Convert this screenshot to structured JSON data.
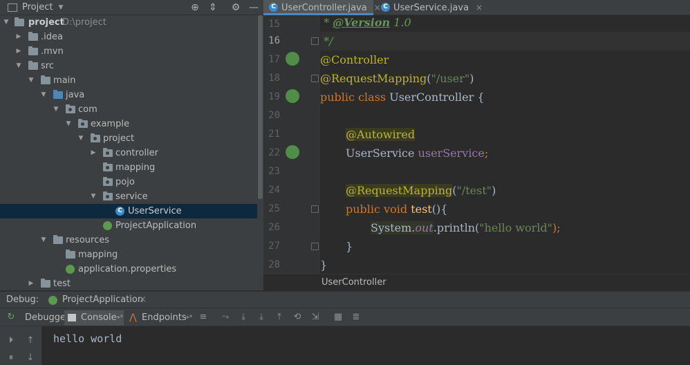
{
  "project_panel": {
    "title": "Project",
    "tree": [
      {
        "label": "project",
        "extra": "D:\\project",
        "bold": true
      },
      {
        "label": ".idea"
      },
      {
        "label": ".mvn"
      },
      {
        "label": "src"
      },
      {
        "label": "main"
      },
      {
        "label": "java"
      },
      {
        "label": "com"
      },
      {
        "label": "example"
      },
      {
        "label": "project"
      },
      {
        "label": "controller"
      },
      {
        "label": "mapping"
      },
      {
        "label": "pojo"
      },
      {
        "label": "service"
      },
      {
        "label": "UserService"
      },
      {
        "label": "ProjectApplication"
      },
      {
        "label": "resources"
      },
      {
        "label": "mapping"
      },
      {
        "label": "application.properties"
      },
      {
        "label": "test"
      }
    ]
  },
  "tabs": [
    {
      "label": "UserController.java",
      "active": true
    },
    {
      "label": "UserService.java",
      "active": false
    }
  ],
  "editor": {
    "line_numbers": [
      "15",
      "16",
      "17",
      "18",
      "19",
      "20",
      "21",
      "22",
      "23",
      "24",
      "25",
      "26",
      "27",
      "28"
    ],
    "current_line": "16",
    "code": {
      "l15_star": " * ",
      "l15_tag": "@Version",
      "l15_val": " 1.0",
      "l16": " */",
      "l17": "@Controller",
      "l18_ann": "@RequestMapping",
      "l18_open": "(",
      "l18_str": "\"/user\"",
      "l18_close": ")",
      "l19_kw": "public class ",
      "l19_rest": "UserController {",
      "l21": "@Autowired",
      "l22_type": "UserService ",
      "l22_field": "userService",
      "l22_semi": ";",
      "l24_ann": "@RequestMapping",
      "l24_open": "(",
      "l24_str": "\"/test\"",
      "l24_close": ")",
      "l25_kw": "public void ",
      "l25_fn": "test",
      "l25_rest": "(){",
      "l26_sys": "System.",
      "l26_out": "out",
      "l26_call": ".println(",
      "l26_str": "\"hello world\"",
      "l26_end": ");",
      "l27": "}",
      "l28": "}"
    },
    "breadcrumb": "UserController"
  },
  "debug": {
    "label": "Debug:",
    "session": "ProjectApplication",
    "tabs": [
      "Debugger",
      "Console",
      "Endpoints"
    ],
    "console_output": "hello world"
  },
  "colors": {
    "keyword": "#cc7832",
    "annotation": "#bbb529",
    "string": "#6a8759",
    "field": "#9876aa",
    "selection": "#0d293e"
  }
}
